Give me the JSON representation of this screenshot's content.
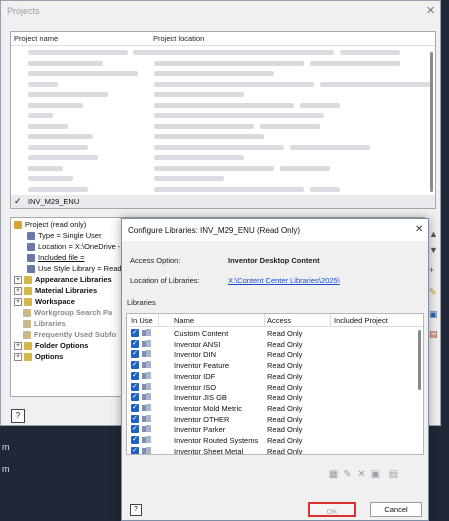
{
  "projects_window": {
    "title": "Projects",
    "columns": {
      "name": "Project name",
      "location": "Project location"
    },
    "selected_project": "INV_M29_ENU",
    "tree": [
      {
        "label": "Project (read only)",
        "style": "normal"
      },
      {
        "label": "Type = Single User",
        "style": "normal"
      },
      {
        "label": "Location = X:\\OneDrive -",
        "style": "normal"
      },
      {
        "label": "Included file =",
        "style": "underline"
      },
      {
        "label": "Use Style Library = Read-",
        "style": "normal"
      },
      {
        "label": "Appearance Libraries",
        "style": "bold"
      },
      {
        "label": "Material Libraries",
        "style": "bold"
      },
      {
        "label": "Workspace",
        "style": "bold"
      },
      {
        "label": "Workgroup Search Pa",
        "style": "grey"
      },
      {
        "label": "Libraries",
        "style": "grey"
      },
      {
        "label": "Frequently Used Subfo",
        "style": "grey"
      },
      {
        "label": "Folder Options",
        "style": "bold"
      },
      {
        "label": "Options",
        "style": "bold"
      }
    ]
  },
  "dialog": {
    "title": "Configure Libraries: INV_M29_ENU (Read Only)",
    "access_label": "Access Option:",
    "access_value": "Inventor Desktop Content",
    "location_label": "Location of Libraries:",
    "location_value": "X:\\Content Center Libraries\\2025\\",
    "libraries_caption": "Libraries",
    "columns": {
      "in_use": "In Use",
      "name": "Name",
      "access": "Access",
      "included": "Included Project"
    },
    "rows": [
      {
        "name": "Custom Content",
        "access": "Read Only"
      },
      {
        "name": "Inventor ANSI",
        "access": "Read Only"
      },
      {
        "name": "Inventor DIN",
        "access": "Read Only"
      },
      {
        "name": "Inventor Feature",
        "access": "Read Only"
      },
      {
        "name": "Inventor IDF",
        "access": "Read Only"
      },
      {
        "name": "Inventor ISO",
        "access": "Read Only"
      },
      {
        "name": "Inventor JIS GB",
        "access": "Read Only"
      },
      {
        "name": "Inventor Mold Metric",
        "access": "Read Only"
      },
      {
        "name": "Inventor OTHER",
        "access": "Read Only"
      },
      {
        "name": "Inventor Parker",
        "access": "Read Only"
      },
      {
        "name": "Inventor Routed Systems",
        "access": "Read Only"
      },
      {
        "name": "Inventor Sheet Metal",
        "access": "Read Only"
      }
    ],
    "ok_label": "OK",
    "cancel_label": "Cancel"
  },
  "colors": {
    "checkbox": "#1e63c4",
    "link": "#1a4fd0",
    "highlight_border": "#d93030"
  }
}
